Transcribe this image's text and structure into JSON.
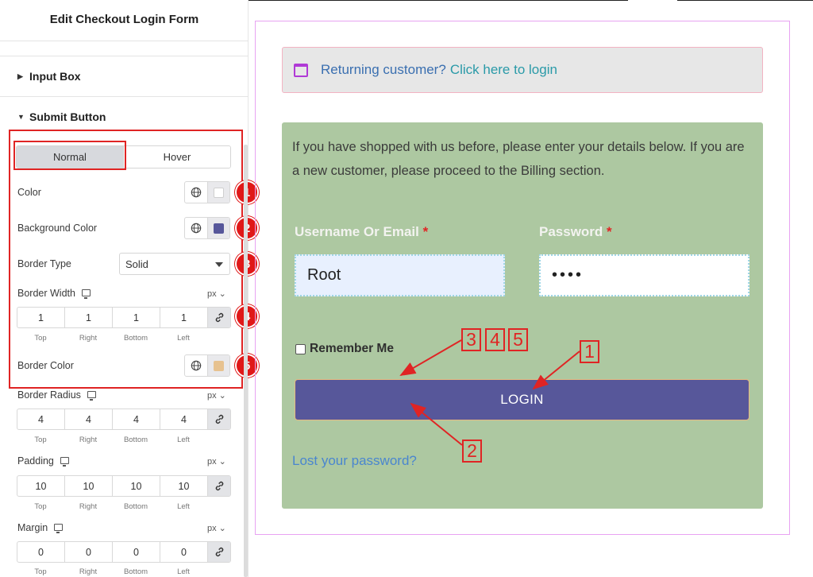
{
  "panel": {
    "title": "Edit Checkout Login Form",
    "sections": {
      "input_box": "Input Box",
      "submit_button": "Submit Button"
    },
    "tabs": {
      "normal": "Normal",
      "hover": "Hover",
      "active": "Normal"
    },
    "color": {
      "label": "Color",
      "value": "#ffffff"
    },
    "background_color": {
      "label": "Background Color",
      "value": "#57579a"
    },
    "border_type": {
      "label": "Border Type",
      "value": "Solid"
    },
    "border_width": {
      "label": "Border Width",
      "unit": "px",
      "top": "1",
      "right": "1",
      "bottom": "1",
      "left": "1"
    },
    "border_color": {
      "label": "Border Color",
      "value": "#e7b981"
    },
    "border_radius": {
      "label": "Border Radius",
      "unit": "px",
      "top": "4",
      "right": "4",
      "bottom": "4",
      "left": "4"
    },
    "padding": {
      "label": "Padding",
      "unit": "px",
      "top": "10",
      "right": "10",
      "bottom": "10",
      "left": "10"
    },
    "margin": {
      "label": "Margin",
      "unit": "px",
      "top": "0",
      "right": "0",
      "bottom": "0",
      "left": "0"
    },
    "dim_labels": {
      "top": "Top",
      "right": "Right",
      "bottom": "Bottom",
      "left": "Left"
    },
    "badges": [
      "1",
      "2",
      "3",
      "4",
      "5"
    ]
  },
  "preview": {
    "notice": {
      "text": "Returning customer?",
      "link": "Click here to login"
    },
    "intro": "If you have shopped with us before, please enter your details below. If you are a new customer, please proceed to the Billing section.",
    "username": {
      "label": "Username Or Email",
      "required": "*",
      "value": "Root"
    },
    "password": {
      "label": "Password",
      "required": "*",
      "value": "••••"
    },
    "remember": "Remember Me",
    "login_button": "LOGIN",
    "lost_password": "Lost your password?",
    "callouts": [
      "3",
      "4",
      "5",
      "1",
      "2"
    ]
  },
  "colors": {
    "annotation_red": "#e02424",
    "form_background": "#adc8a1",
    "button_background": "#57579a",
    "frame_border": "#e8a3f2"
  }
}
